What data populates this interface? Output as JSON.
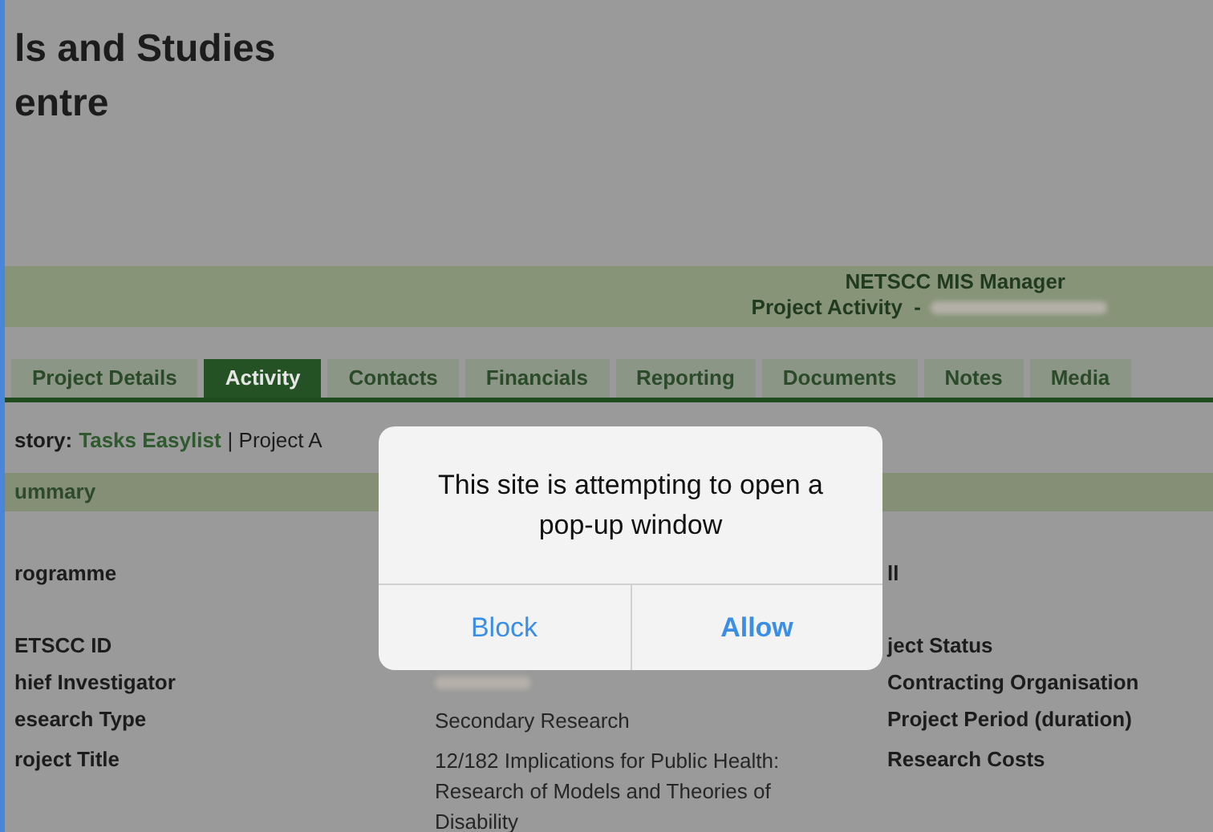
{
  "header": {
    "title_lines": [
      "ls and Studies",
      "entre"
    ]
  },
  "banner": {
    "app_name": "NETSCC MIS Manager",
    "page_label": "Project Activity  -",
    "redacted_name": true
  },
  "tabs": [
    {
      "label": "Project Details",
      "selected": false
    },
    {
      "label": "Activity",
      "selected": true
    },
    {
      "label": "Contacts",
      "selected": false
    },
    {
      "label": "Financials",
      "selected": false
    },
    {
      "label": "Reporting",
      "selected": false
    },
    {
      "label": "Documents",
      "selected": false
    },
    {
      "label": "Notes",
      "selected": false
    },
    {
      "label": "Media",
      "selected": false
    }
  ],
  "breadcrumb": {
    "label": "story:",
    "link": "Tasks Easylist",
    "rest": "| Project A"
  },
  "section": {
    "title": "ummary"
  },
  "rows": [
    {
      "label": "rogramme",
      "value": "",
      "right": "ll"
    },
    {
      "label": "ETSCC ID",
      "value": "",
      "right": "ject Status"
    },
    {
      "label": "hief Investigator",
      "value": "",
      "redacted": true,
      "right": "Contracting Organisation"
    },
    {
      "label": "esearch Type",
      "value": "Secondary Research",
      "right": "Project Period (duration)"
    },
    {
      "label": "roject Title",
      "value": "12/182 Implications for Public Health: Research of Models and Theories of Disability",
      "right": "Research Costs"
    }
  ],
  "dialog": {
    "message": "This site is attempting to open a pop-up window",
    "buttons": [
      "Block",
      "Allow"
    ]
  }
}
